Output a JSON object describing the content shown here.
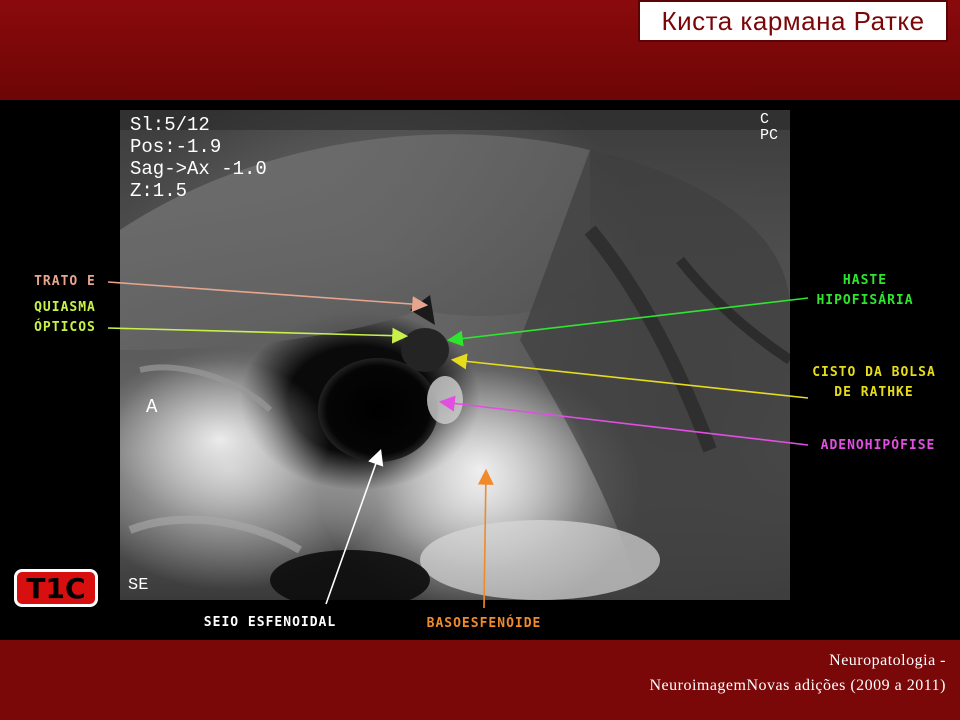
{
  "slide": {
    "title": "Киста кармана Ратке",
    "sequence_badge": "T1C",
    "credit_line1": "Neuropatologia  -",
    "credit_line2": "NeuroimagemNovas  adições  (2009  a  2011)"
  },
  "scan": {
    "info_lines": "Sl:5/12\nPos:-1.9\nSag->Ax -1.0\nZ:1.5",
    "orientation_anterior": "A",
    "corner_text": "SE",
    "top_right_text": "C \nPC"
  },
  "labels": {
    "trato_line1": "TRATO E",
    "trato_line2": "QUIASMA",
    "trato_line3": "ÓPTICOS",
    "haste_line1": "HASTE",
    "haste_line2": "HIPOFISÁRIA",
    "cisto_line1": "CISTO DA BOLSA",
    "cisto_line2": "DE RATHKE",
    "adeno": "ADENOHIPÓFISE",
    "seio": "SEIO ESFENOIDAL",
    "baso": "BASOESFENÓIDE"
  },
  "colors": {
    "header_red": "#8a0a0c",
    "trato_arrow": "#e8a58e",
    "quiasma_arrow": "#c8f24a",
    "haste": "#2ee62e",
    "cisto": "#e6dc1e",
    "adeno": "#e24ee2",
    "seio": "#ffffff",
    "baso": "#f08a2a",
    "badge": "#d80f0f"
  }
}
